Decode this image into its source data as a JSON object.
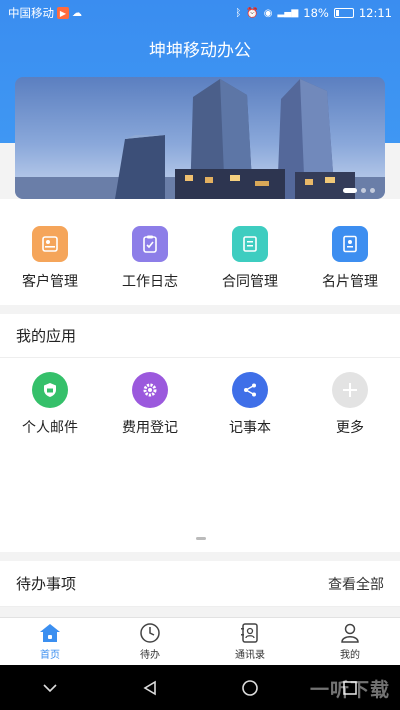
{
  "status_bar": {
    "carrier": "中国移动",
    "battery": "18%",
    "time": "12:11"
  },
  "app_title": "坤坤移动办公",
  "banner": {
    "slide_count": 3,
    "active_slide": 1
  },
  "quick_actions": [
    {
      "label": "客户管理",
      "icon": "customer-card-icon",
      "color": "#f5a55a"
    },
    {
      "label": "工作日志",
      "icon": "clipboard-check-icon",
      "color": "#8d7ee8"
    },
    {
      "label": "合同管理",
      "icon": "contract-doc-icon",
      "color": "#3ecdc0"
    },
    {
      "label": "名片管理",
      "icon": "business-card-icon",
      "color": "#3d8ef0"
    }
  ],
  "my_apps": {
    "title": "我的应用",
    "items": [
      {
        "label": "个人邮件",
        "icon": "shield-mail-icon",
        "color": "#35c06a"
      },
      {
        "label": "费用登记",
        "icon": "gear-icon",
        "color": "#9b59dd"
      },
      {
        "label": "记事本",
        "icon": "share-nodes-icon",
        "color": "#3f6fe8"
      },
      {
        "label": "更多",
        "icon": "plus-icon",
        "color": "#e3e3e3"
      }
    ]
  },
  "todo": {
    "title": "待办事项",
    "view_all": "查看全部"
  },
  "tabbar": [
    {
      "label": "首页",
      "icon": "home-icon",
      "active": true
    },
    {
      "label": "待办",
      "icon": "clock-icon",
      "active": false
    },
    {
      "label": "通讯录",
      "icon": "contacts-icon",
      "active": false
    },
    {
      "label": "我的",
      "icon": "person-icon",
      "active": false
    }
  ],
  "watermark": "一听下载",
  "accent_color": "#3b8ff0"
}
